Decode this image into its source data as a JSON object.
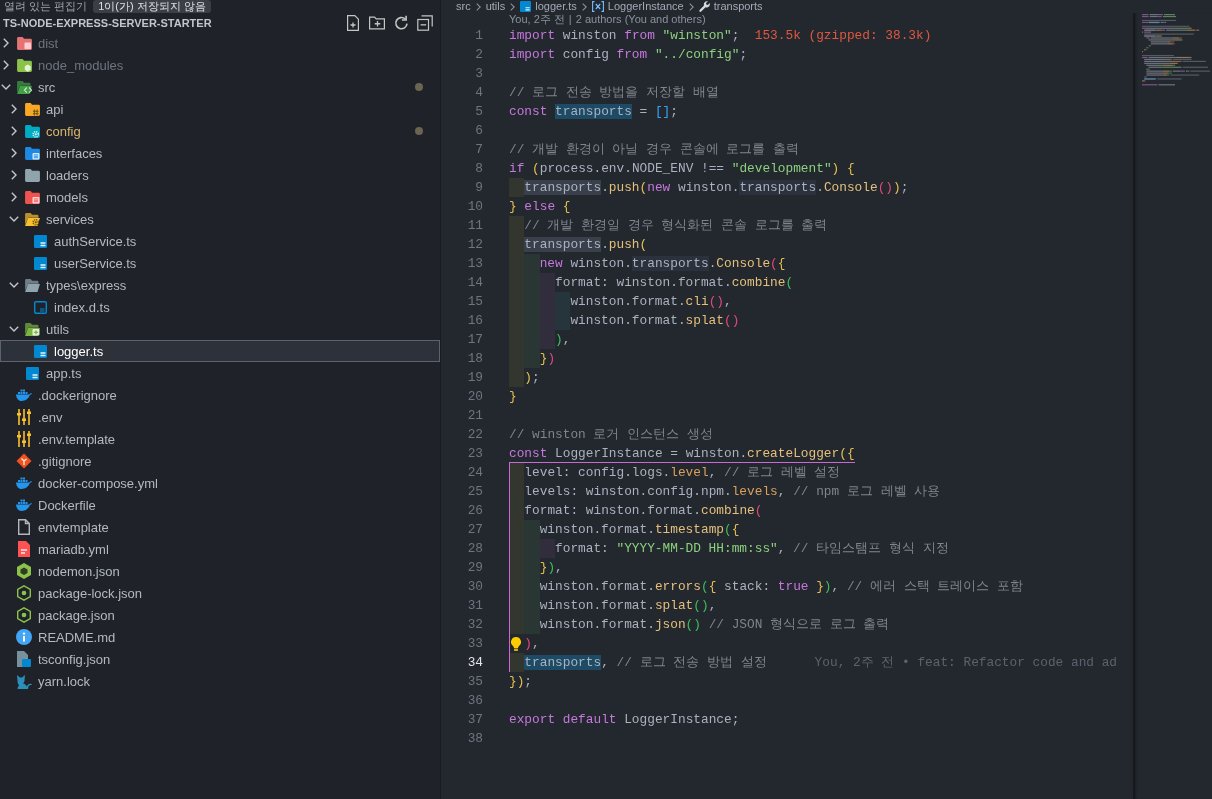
{
  "sidebar": {
    "open_editors": {
      "title": "열려 있는 편집기",
      "badge": "1이(가) 저장되지 않음"
    },
    "explorer": {
      "title": "TS-NODE-EXPRESS-SERVER-STARTER"
    },
    "tree": [
      {
        "label": "dist",
        "kind": "dist",
        "expanded": false,
        "selected": false,
        "ignored": true,
        "modified": false,
        "dot": false
      },
      {
        "label": "node_modules",
        "kind": "modules",
        "expanded": false,
        "selected": false,
        "ignored": true,
        "modified": false,
        "dot": false
      },
      {
        "label": "src",
        "kind": "src",
        "expanded": true,
        "selected": false,
        "ignored": false,
        "modified": false,
        "dot": true,
        "children": [
          {
            "label": "api",
            "kind": "api",
            "expanded": false,
            "selected": false,
            "ignored": false,
            "modified": false,
            "dot": false
          },
          {
            "label": "config",
            "kind": "config",
            "expanded": false,
            "selected": false,
            "ignored": false,
            "modified": true,
            "dot": true
          },
          {
            "label": "interfaces",
            "kind": "interfaces",
            "expanded": false,
            "selected": false,
            "ignored": false,
            "modified": false,
            "dot": false
          },
          {
            "label": "loaders",
            "kind": "loaders",
            "expanded": false,
            "selected": false,
            "ignored": false,
            "modified": false,
            "dot": false
          },
          {
            "label": "models",
            "kind": "models",
            "expanded": false,
            "selected": false,
            "ignored": false,
            "modified": false,
            "dot": false
          },
          {
            "label": "services",
            "kind": "services",
            "expanded": true,
            "selected": false,
            "ignored": false,
            "modified": false,
            "dot": false,
            "children": [
              {
                "label": "authService.ts",
                "kind": "ts",
                "selected": false,
                "ignored": false,
                "modified": false,
                "dot": false
              },
              {
                "label": "userService.ts",
                "kind": "ts",
                "selected": false,
                "ignored": false,
                "modified": false,
                "dot": false
              }
            ]
          },
          {
            "label": "types\\express",
            "kind": "types",
            "expanded": true,
            "selected": false,
            "ignored": false,
            "modified": false,
            "dot": false,
            "children": [
              {
                "label": "index.d.ts",
                "kind": "dts",
                "selected": false,
                "ignored": false,
                "modified": false,
                "dot": false
              }
            ]
          },
          {
            "label": "utils",
            "kind": "utils",
            "expanded": true,
            "selected": false,
            "ignored": false,
            "modified": false,
            "dot": false,
            "children": [
              {
                "label": "logger.ts",
                "kind": "ts",
                "selected": true,
                "ignored": false,
                "modified": false,
                "dot": false
              }
            ]
          },
          {
            "label": "app.ts",
            "kind": "ts",
            "selected": false,
            "ignored": false,
            "modified": false,
            "dot": false
          }
        ]
      },
      {
        "label": ".dockerignore",
        "kind": "docker",
        "selected": false,
        "ignored": false,
        "modified": false,
        "dot": false
      },
      {
        "label": ".env",
        "kind": "env",
        "selected": false,
        "ignored": false,
        "modified": false,
        "dot": false
      },
      {
        "label": ".env.template",
        "kind": "env",
        "selected": false,
        "ignored": false,
        "modified": false,
        "dot": false
      },
      {
        "label": ".gitignore",
        "kind": "git",
        "selected": false,
        "ignored": false,
        "modified": false,
        "dot": false
      },
      {
        "label": "docker-compose.yml",
        "kind": "docker",
        "selected": false,
        "ignored": false,
        "modified": false,
        "dot": false
      },
      {
        "label": "Dockerfile",
        "kind": "docker",
        "selected": false,
        "ignored": false,
        "modified": false,
        "dot": false
      },
      {
        "label": "envtemplate",
        "kind": "file",
        "selected": false,
        "ignored": false,
        "modified": false,
        "dot": false
      },
      {
        "label": "mariadb.yml",
        "kind": "yaml",
        "selected": false,
        "ignored": false,
        "modified": false,
        "dot": false
      },
      {
        "label": "nodemon.json",
        "kind": "nodemon",
        "selected": false,
        "ignored": false,
        "modified": false,
        "dot": false
      },
      {
        "label": "package-lock.json",
        "kind": "npm",
        "selected": false,
        "ignored": false,
        "modified": false,
        "dot": false
      },
      {
        "label": "package.json",
        "kind": "npm",
        "selected": false,
        "ignored": false,
        "modified": false,
        "dot": false
      },
      {
        "label": "README.md",
        "kind": "info",
        "selected": false,
        "ignored": false,
        "modified": false,
        "dot": false
      },
      {
        "label": "tsconfig.json",
        "kind": "tsconfig",
        "selected": false,
        "ignored": false,
        "modified": false,
        "dot": false
      },
      {
        "label": "yarn.lock",
        "kind": "yarn",
        "selected": false,
        "ignored": false,
        "modified": false,
        "dot": false
      }
    ]
  },
  "editor": {
    "breadcrumbs": [
      {
        "kind": "folder",
        "label": "src"
      },
      {
        "kind": "folder",
        "label": "utils"
      },
      {
        "kind": "file",
        "label": "logger.ts"
      },
      {
        "kind": "variable",
        "label": "LoggerInstance"
      },
      {
        "kind": "property",
        "label": "transports"
      }
    ],
    "codelens": {
      "items": [
        "You, 2주 전",
        "2 authors (You and others)"
      ],
      "separator": "|"
    },
    "lines": [
      {
        "number": "1",
        "active": false,
        "lightbulb": false,
        "bracket_guide": false,
        "tokens": [
          {
            "kind": "keyword",
            "text": "import"
          },
          {
            "kind": "plain",
            "text": " winston "
          },
          {
            "kind": "keyword",
            "text": "from"
          },
          {
            "kind": "string",
            "text": " \"winston\""
          },
          {
            "kind": "plain",
            "text": ";"
          }
        ],
        "annotation": {
          "kind": "size",
          "text": "153.5k (gzipped: 38.3k)"
        }
      },
      {
        "number": "2",
        "active": false,
        "lightbulb": false,
        "bracket_guide": false,
        "tokens": [
          {
            "kind": "keyword",
            "text": "import"
          },
          {
            "kind": "plain",
            "text": " config "
          },
          {
            "kind": "keyword",
            "text": "from"
          },
          {
            "kind": "string",
            "text": " \"../config\""
          },
          {
            "kind": "plain",
            "text": ";"
          }
        ]
      },
      {
        "number": "3",
        "active": false,
        "lightbulb": false
      },
      {
        "number": "4",
        "active": false,
        "lightbulb": false,
        "bracket_guide": false,
        "tokens": [
          {
            "kind": "comment",
            "text": "// 로그 전송 방법을 저장할 배열"
          }
        ]
      },
      {
        "number": "5",
        "active": false,
        "lightbulb": false,
        "bracket_guide": false,
        "tokens": [
          {
            "kind": "keyword",
            "text": "const "
          },
          {
            "kind": "match",
            "text": "transports"
          },
          {
            "kind": "plain",
            "text": " = "
          },
          {
            "kind": "bracket4",
            "text": "[]"
          },
          {
            "kind": "plain",
            "text": ";"
          }
        ]
      },
      {
        "number": "6",
        "active": false,
        "lightbulb": false
      },
      {
        "number": "7",
        "active": false,
        "lightbulb": false,
        "bracket_guide": false,
        "tokens": [
          {
            "kind": "comment",
            "text": "// 개발 환경이 아닐 경우 콘솔에 로그를 출력"
          }
        ]
      },
      {
        "number": "8",
        "active": false,
        "lightbulb": false,
        "bracket_guide": false,
        "tokens": [
          {
            "kind": "keyword",
            "text": "if "
          },
          {
            "kind": "bracket1",
            "text": "("
          },
          {
            "kind": "plain",
            "text": "process.env.NODE_ENV !== "
          },
          {
            "kind": "string",
            "text": "\"development\""
          },
          {
            "kind": "bracket1",
            "text": ") {"
          }
        ]
      },
      {
        "number": "9",
        "active": false,
        "lightbulb": false,
        "bracket_guide": false,
        "tokens": [
          {
            "kind": "occurrence",
            "text": "  transports"
          },
          {
            "kind": "plain",
            "text": "."
          },
          {
            "kind": "function",
            "text": "push"
          },
          {
            "kind": "bracket1",
            "text": "("
          },
          {
            "kind": "keyword",
            "text": "new"
          },
          {
            "kind": "plain",
            "text": " winston."
          },
          {
            "kind": "textual",
            "text": "transports"
          },
          {
            "kind": "plain",
            "text": "."
          },
          {
            "kind": "function",
            "text": "Console"
          },
          {
            "kind": "bracket2",
            "text": "()"
          },
          {
            "kind": "bracket1",
            "text": ")"
          },
          {
            "kind": "plain",
            "text": ";"
          }
        ]
      },
      {
        "number": "10",
        "active": false,
        "lightbulb": false,
        "bracket_guide": false,
        "tokens": [
          {
            "kind": "bracket1",
            "text": "}"
          },
          {
            "kind": "keyword",
            "text": " else "
          },
          {
            "kind": "bracket1",
            "text": "{"
          }
        ]
      },
      {
        "number": "11",
        "active": false,
        "lightbulb": false,
        "bracket_guide": false,
        "tokens": [
          {
            "kind": "comment",
            "text": "  // 개발 환경일 경우 형식화된 콘솔 로그를 출력"
          }
        ]
      },
      {
        "number": "12",
        "active": false,
        "lightbulb": false,
        "bracket_guide": false,
        "tokens": [
          {
            "kind": "occurrence",
            "text": "  transports"
          },
          {
            "kind": "plain",
            "text": "."
          },
          {
            "kind": "function",
            "text": "push"
          },
          {
            "kind": "bracket1",
            "text": "("
          }
        ]
      },
      {
        "number": "13",
        "active": false,
        "lightbulb": false,
        "bracket_guide": false,
        "tokens": [
          {
            "kind": "keyword",
            "text": "    new"
          },
          {
            "kind": "plain",
            "text": " winston."
          },
          {
            "kind": "textual",
            "text": "transports"
          },
          {
            "kind": "plain",
            "text": "."
          },
          {
            "kind": "function",
            "text": "Console"
          },
          {
            "kind": "bracket2",
            "text": "("
          },
          {
            "kind": "bracket1",
            "text": "{"
          }
        ]
      },
      {
        "number": "14",
        "active": false,
        "lightbulb": false,
        "bracket_guide": false,
        "tokens": [
          {
            "kind": "plain",
            "text": "      format: winston.format."
          },
          {
            "kind": "function",
            "text": "combine"
          },
          {
            "kind": "bracket3",
            "text": "("
          }
        ]
      },
      {
        "number": "15",
        "active": false,
        "lightbulb": false,
        "bracket_guide": false,
        "tokens": [
          {
            "kind": "plain",
            "text": "        winston.format."
          },
          {
            "kind": "function",
            "text": "cli"
          },
          {
            "kind": "bracket2",
            "text": "()"
          },
          {
            "kind": "plain",
            "text": ","
          }
        ]
      },
      {
        "number": "16",
        "active": false,
        "lightbulb": false,
        "bracket_guide": false,
        "tokens": [
          {
            "kind": "plain",
            "text": "        winston.format."
          },
          {
            "kind": "function",
            "text": "splat"
          },
          {
            "kind": "bracket2",
            "text": "()"
          }
        ]
      },
      {
        "number": "17",
        "active": false,
        "lightbulb": false,
        "bracket_guide": false,
        "tokens": [
          {
            "kind": "bracket3",
            "text": "      )"
          },
          {
            "kind": "plain",
            "text": ","
          }
        ]
      },
      {
        "number": "18",
        "active": false,
        "lightbulb": false,
        "bracket_guide": false,
        "tokens": [
          {
            "kind": "bracket1",
            "text": "    }"
          },
          {
            "kind": "bracket2",
            "text": ")"
          }
        ]
      },
      {
        "number": "19",
        "active": false,
        "lightbulb": false,
        "bracket_guide": false,
        "tokens": [
          {
            "kind": "bracket1",
            "text": "  )"
          },
          {
            "kind": "plain",
            "text": ";"
          }
        ]
      },
      {
        "number": "20",
        "active": false,
        "lightbulb": false,
        "bracket_guide": false,
        "tokens": [
          {
            "kind": "bracket1",
            "text": "}"
          }
        ]
      },
      {
        "number": "21",
        "active": false,
        "lightbulb": false
      },
      {
        "number": "22",
        "active": false,
        "lightbulb": false,
        "bracket_guide": false,
        "tokens": [
          {
            "kind": "comment",
            "text": "// winston 로거 인스턴스 생성"
          }
        ]
      },
      {
        "number": "23",
        "active": false,
        "lightbulb": false,
        "bracket_guide": true,
        "tokens": [
          {
            "kind": "keyword",
            "text": "const"
          },
          {
            "kind": "plain",
            "text": " LoggerInstance = winston."
          },
          {
            "kind": "function",
            "text": "createLogger"
          },
          {
            "kind": "bracket1",
            "text": "({"
          }
        ]
      },
      {
        "number": "24",
        "active": false,
        "lightbulb": false,
        "bracket_guide": true,
        "tokens": [
          {
            "kind": "plain",
            "text": "  level: config.logs."
          },
          {
            "kind": "member",
            "text": "level"
          },
          {
            "kind": "plain",
            "text": ","
          },
          {
            "kind": "comment",
            "text": " // 로그 레벨 설정"
          }
        ]
      },
      {
        "number": "25",
        "active": false,
        "lightbulb": false,
        "bracket_guide": true,
        "tokens": [
          {
            "kind": "plain",
            "text": "  levels: winston.config.npm."
          },
          {
            "kind": "member",
            "text": "levels"
          },
          {
            "kind": "plain",
            "text": ","
          },
          {
            "kind": "comment",
            "text": " // npm 로그 레벨 사용"
          }
        ]
      },
      {
        "number": "26",
        "active": false,
        "lightbulb": false,
        "bracket_guide": true,
        "tokens": [
          {
            "kind": "plain",
            "text": "  format: winston.format."
          },
          {
            "kind": "function",
            "text": "combine"
          },
          {
            "kind": "bracket2",
            "text": "("
          }
        ]
      },
      {
        "number": "27",
        "active": false,
        "lightbulb": false,
        "bracket_guide": true,
        "tokens": [
          {
            "kind": "plain",
            "text": "    winston.format."
          },
          {
            "kind": "function",
            "text": "timestamp"
          },
          {
            "kind": "bracket3",
            "text": "("
          },
          {
            "kind": "bracket1",
            "text": "{"
          }
        ]
      },
      {
        "number": "28",
        "active": false,
        "lightbulb": false,
        "bracket_guide": true,
        "tokens": [
          {
            "kind": "plain",
            "text": "      format: "
          },
          {
            "kind": "string",
            "text": "\"YYYY-MM-DD HH:mm:ss\""
          },
          {
            "kind": "plain",
            "text": ","
          },
          {
            "kind": "comment",
            "text": " // 타임스탬프 형식 지정"
          }
        ]
      },
      {
        "number": "29",
        "active": false,
        "lightbulb": false,
        "bracket_guide": true,
        "tokens": [
          {
            "kind": "bracket1",
            "text": "    }"
          },
          {
            "kind": "bracket3",
            "text": ")"
          },
          {
            "kind": "plain",
            "text": ","
          }
        ]
      },
      {
        "number": "30",
        "active": false,
        "lightbulb": false,
        "bracket_guide": true,
        "tokens": [
          {
            "kind": "plain",
            "text": "    winston.format."
          },
          {
            "kind": "function",
            "text": "errors"
          },
          {
            "kind": "bracket3",
            "text": "("
          },
          {
            "kind": "bracket1",
            "text": "{"
          },
          {
            "kind": "plain",
            "text": " stack: "
          },
          {
            "kind": "keyword",
            "text": "true"
          },
          {
            "kind": "bracket1",
            "text": " }"
          },
          {
            "kind": "bracket3",
            "text": ")"
          },
          {
            "kind": "plain",
            "text": ","
          },
          {
            "kind": "comment",
            "text": " // 에러 스택 트레이스 포함"
          }
        ]
      },
      {
        "number": "31",
        "active": false,
        "lightbulb": false,
        "bracket_guide": true,
        "tokens": [
          {
            "kind": "plain",
            "text": "    winston.format."
          },
          {
            "kind": "function",
            "text": "splat"
          },
          {
            "kind": "bracket3",
            "text": "()"
          },
          {
            "kind": "plain",
            "text": ","
          }
        ]
      },
      {
        "number": "32",
        "active": false,
        "lightbulb": false,
        "bracket_guide": true,
        "tokens": [
          {
            "kind": "plain",
            "text": "    winston.format."
          },
          {
            "kind": "function",
            "text": "json"
          },
          {
            "kind": "bracket3",
            "text": "()"
          },
          {
            "kind": "comment",
            "text": " // JSON 형식으로 로그 출력"
          }
        ]
      },
      {
        "number": "33",
        "active": false,
        "lightbulb": true,
        "bracket_guide": true,
        "tokens": [
          {
            "kind": "bracket2",
            "text": "  )"
          },
          {
            "kind": "plain",
            "text": ","
          }
        ]
      },
      {
        "number": "34",
        "active": true,
        "lightbulb": false,
        "bracket_guide": true,
        "tokens": [
          {
            "kind": "match",
            "text": "  transports"
          },
          {
            "kind": "plain",
            "text": ","
          },
          {
            "kind": "comment",
            "text": " // 로그 전송 방법 설정"
          }
        ],
        "annotation": {
          "kind": "blame",
          "text": "You, 2주 전 • feat: Refactor code and ad"
        }
      },
      {
        "number": "35",
        "active": false,
        "lightbulb": false,
        "bracket_guide": false,
        "tokens": [
          {
            "kind": "bracket1",
            "text": "})"
          },
          {
            "kind": "plain",
            "text": ";"
          }
        ]
      },
      {
        "number": "36",
        "active": false,
        "lightbulb": false
      },
      {
        "number": "37",
        "active": false,
        "lightbulb": false,
        "bracket_guide": false,
        "tokens": [
          {
            "kind": "keyword",
            "text": "export default"
          },
          {
            "kind": "plain",
            "text": " LoggerInstance;"
          }
        ]
      },
      {
        "number": "38",
        "active": false,
        "lightbulb": false
      }
    ]
  }
}
